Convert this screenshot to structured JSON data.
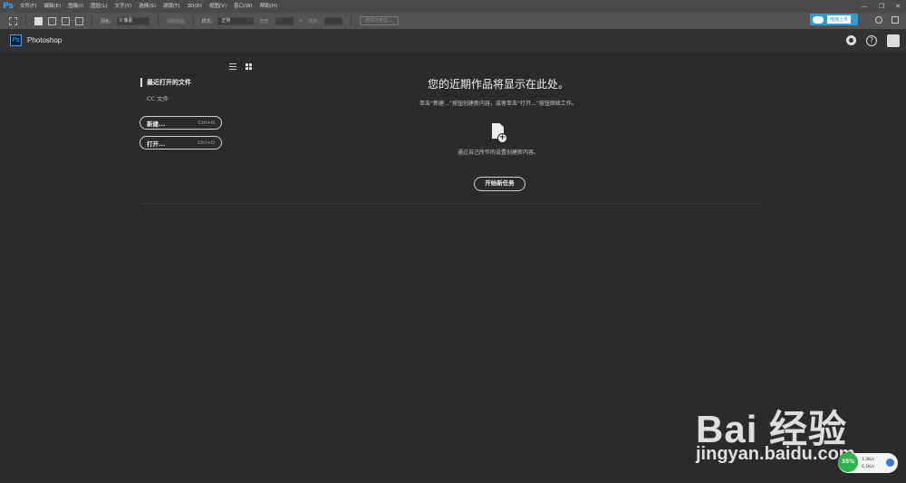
{
  "menubar": {
    "logo": "Ps",
    "items": [
      "文件(F)",
      "编辑(E)",
      "图像(I)",
      "图层(L)",
      "文字(Y)",
      "选择(S)",
      "滤镜(T)",
      "3D(D)",
      "视图(V)",
      "窗口(W)",
      "帮助(H)"
    ],
    "window_controls": [
      "—",
      "❐",
      "✕"
    ]
  },
  "optionsbar": {
    "feather_label": "羽化:",
    "feather_value": "0 像素",
    "antialias_label": "消除锯齿",
    "style_label": "样式:",
    "style_value": "正常",
    "width_label": "宽度:",
    "height_label": "高度:",
    "select_mask_label": "选择并遮住 ...",
    "upload_label": "拖拽上传"
  },
  "header": {
    "logo": "Ps",
    "title": "Photoshop"
  },
  "start": {
    "recent_title": "最近打开的文件",
    "cc_files": "CC 文件",
    "new_label": "新建...",
    "new_shortcut": "Ctrl+N",
    "open_label": "打开...",
    "open_shortcut": "Ctrl+O",
    "heading": "您的近期作品将显示在此处。",
    "subtext": "单击“新建...”按钮创建新内容，或者单击“打开...”按钮继续工作。",
    "create_text": "通过自己所作的设置创建新内容。",
    "start_button": "开始新任务"
  },
  "watermark": {
    "logo": "Bai 经验",
    "url": "jingyan.baidu.com"
  },
  "net_widget": {
    "percent": "35%",
    "up": "1.3K/s",
    "down": "6.1K/s"
  }
}
